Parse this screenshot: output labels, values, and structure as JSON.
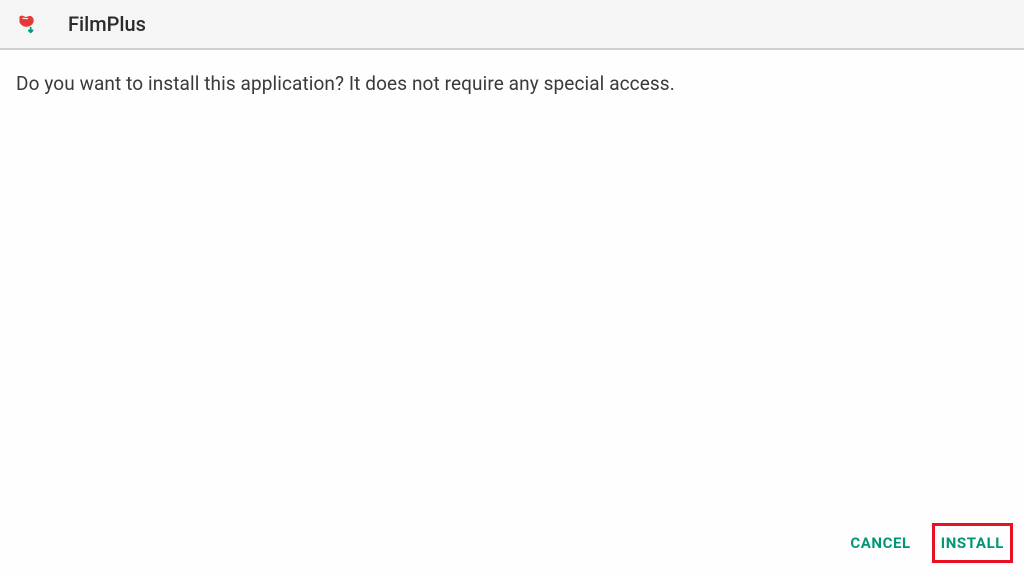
{
  "header": {
    "app_title": "FilmPlus",
    "icon_name": "filmplus-icon"
  },
  "content": {
    "message": "Do you want to install this application? It does not require any special access."
  },
  "footer": {
    "cancel_label": "CANCEL",
    "install_label": "INSTALL"
  },
  "colors": {
    "accent": "#009676",
    "highlight": "#e81123"
  }
}
